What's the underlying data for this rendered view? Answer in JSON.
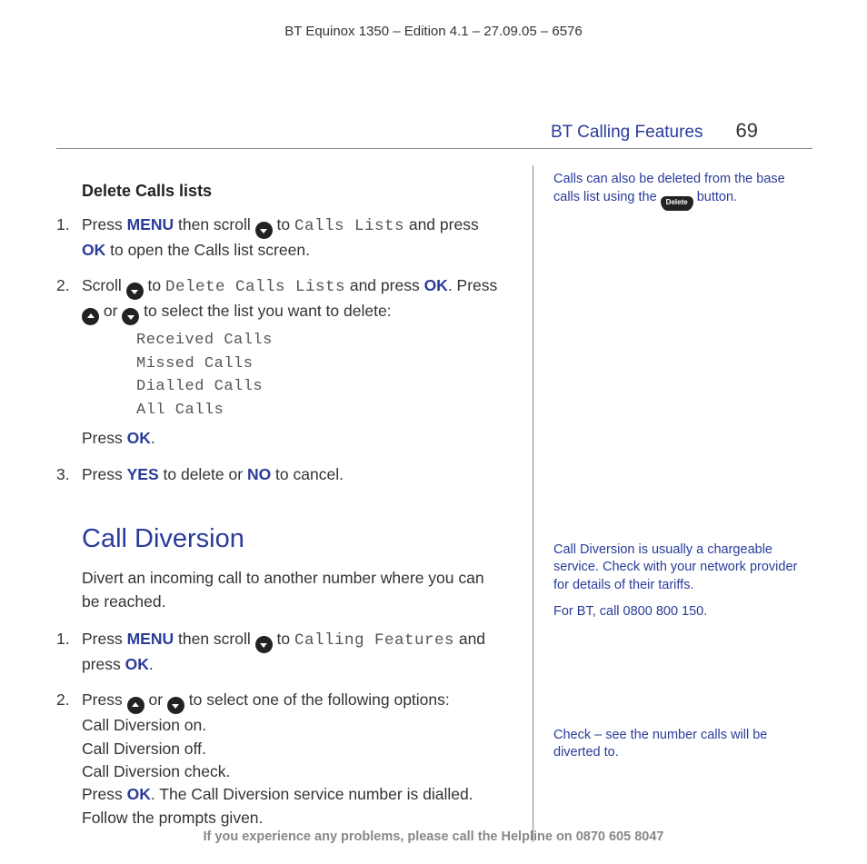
{
  "header": "BT Equinox 1350 – Edition 4.1 – 27.09.05 – 6576",
  "section": {
    "title": "BT Calling Features",
    "page": "69"
  },
  "delete_calls": {
    "heading": "Delete Calls lists",
    "step1_a": "Press ",
    "step1_menu": "MENU",
    "step1_b": " then scroll ",
    "step1_c": " to ",
    "step1_lcd1": "Calls Lists",
    "step1_d": " and press ",
    "step1_ok": "OK",
    "step1_e": " to open the Calls list screen.",
    "step2_a": "Scroll ",
    "step2_b": " to ",
    "step2_lcd": "Delete Calls Lists",
    "step2_c": " and press ",
    "step2_ok1": "OK",
    "step2_d": ". Press ",
    "step2_e": " or ",
    "step2_f": " to select the list you want to delete:",
    "options": [
      "Received Calls",
      "Missed Calls",
      "Dialled Calls",
      "All Calls"
    ],
    "step2_press": "Press ",
    "step2_ok2": "OK",
    "step2_dot": ".",
    "step3_a": "Press ",
    "step3_yes": "YES",
    "step3_b": " to delete or ",
    "step3_no": "NO",
    "step3_c": " to cancel."
  },
  "diversion": {
    "heading": "Call Diversion",
    "intro": "Divert an incoming call to another number where you can be reached.",
    "s1_a": "Press ",
    "s1_menu": "MENU",
    "s1_b": " then scroll ",
    "s1_c": " to ",
    "s1_lcd": "Calling Features",
    "s1_d": " and press ",
    "s1_ok": "OK",
    "s1_dot": ".",
    "s2_a": "Press ",
    "s2_b": " or ",
    "s2_c": " to select one of the following options:",
    "s2_opt1": "Call Diversion on.",
    "s2_opt2": "Call Diversion off.",
    "s2_opt3": "Call Diversion check.",
    "s2_press": "Press ",
    "s2_ok": "OK",
    "s2_tail": ". The Call Diversion service number is dialled. Follow the prompts given."
  },
  "side": {
    "note1_a": "Calls can also be deleted from the base calls list using the ",
    "note1_badge": "Delete",
    "note1_b": " button.",
    "note2_a": "Call Diversion is usually a chargeable service. Check with your network provider for details of their tariffs.",
    "note2_b": "For BT, call 0800 800 150.",
    "note3": "Check – see the number calls will be diverted to."
  },
  "footer": {
    "text_a": "If you experience any problems, please call the Helpline on ",
    "phone": "0870 605 8047"
  }
}
